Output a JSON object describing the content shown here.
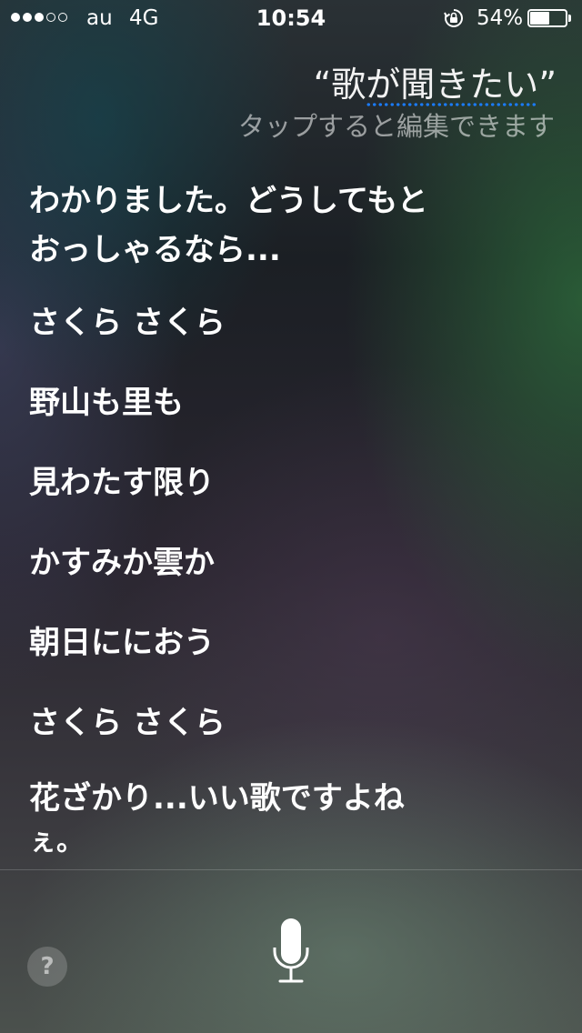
{
  "status_bar": {
    "signal_filled": 3,
    "signal_total": 5,
    "carrier": "au",
    "network": "4G",
    "time": "10:54",
    "battery_percent_text": "54%",
    "battery_level": 0.54,
    "icons": [
      "signal-dots",
      "orientation-lock-icon",
      "battery-icon"
    ]
  },
  "query": {
    "open_quote": "“",
    "text_plain": "歌",
    "text_underlined": "が聞きたい",
    "close_quote": "”",
    "edit_hint": "タップすると編集できます"
  },
  "response": {
    "intro_line1": "わかりました。どうしてもと",
    "intro_line2": "おっしゃるなら...",
    "lyrics": [
      "さくら さくら",
      "野山も里も",
      "見わたす限り",
      "かすみか雲か",
      "朝日ににおう",
      "さくら さくら"
    ],
    "closing_line1": "花ざかり...いい歌ですよね",
    "closing_line2": "ぇ。"
  },
  "bottom": {
    "help_label": "?",
    "mic_icon": "microphone-icon"
  },
  "colors": {
    "underline_dots": "#1a7cff",
    "text": "#ffffff"
  }
}
